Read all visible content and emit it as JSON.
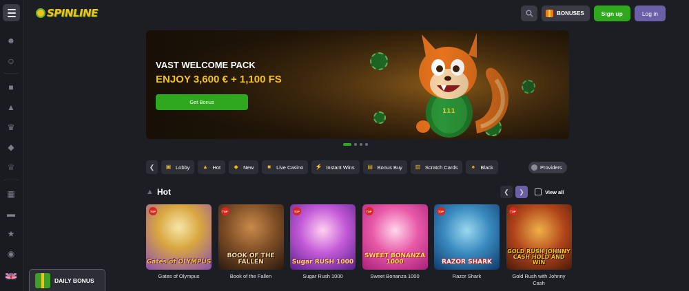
{
  "brand": {
    "logo_text": "SPINLINE"
  },
  "header": {
    "bonuses_label": "BONUSES",
    "signup_label": "Sign up",
    "login_label": "Log in"
  },
  "banner": {
    "title": "VAST WELCOME PACK",
    "subtitle": "ENJOY 3,600 € + 1,100 FS",
    "cta_label": "Get Bonus",
    "slides_total": 4,
    "slide_active": 1
  },
  "categories": [
    {
      "label": "Lobby",
      "icon": "lobby-icon"
    },
    {
      "label": "Hot",
      "icon": "fire-icon"
    },
    {
      "label": "New",
      "icon": "diamond-icon"
    },
    {
      "label": "Live Casino",
      "icon": "camera-icon"
    },
    {
      "label": "Instant Wins",
      "icon": "lightning-icon"
    },
    {
      "label": "Bonus Buy",
      "icon": "bag-icon"
    },
    {
      "label": "Scratch Cards",
      "icon": "card-icon"
    },
    {
      "label": "Black",
      "icon": "cards-icon"
    }
  ],
  "providers_label": "Providers",
  "section": {
    "title": "Hot",
    "view_all_label": "View all"
  },
  "games": [
    {
      "name": "Gates of Olympus",
      "art_text": "Gates of OLYMPUS",
      "badge": "TOP"
    },
    {
      "name": "Book of the Fallen",
      "art_text": "BOOK OF THE FALLEN",
      "badge": "TOP"
    },
    {
      "name": "Sugar Rush 1000",
      "art_text": "Sugar RUSH 1000",
      "badge": "TOP"
    },
    {
      "name": "Sweet Bonanza 1000",
      "art_text": "SWEET BONANZA 1000",
      "badge": "TOP"
    },
    {
      "name": "Razor Shark",
      "art_text": "RAZOR SHARK",
      "badge": "TOP"
    },
    {
      "name": "Gold Rush with Johnny Cash",
      "art_text": "GOLD RUSH JOHNNY CASH HOLD AND WIN",
      "badge": "TOP"
    }
  ],
  "daily_bonus_label": "DAILY BONUS",
  "colors": {
    "accent_green": "#2fa81e",
    "accent_purple": "#6b5fa8",
    "gold": "#f4c21d",
    "background": "#1d1e24"
  }
}
